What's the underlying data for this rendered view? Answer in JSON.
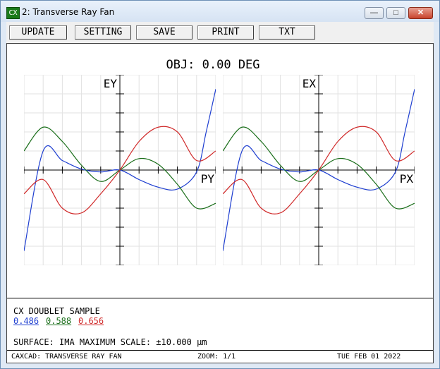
{
  "window": {
    "title": "2: Transverse Ray Fan",
    "icon_label": "CX"
  },
  "toolbar": {
    "buttons": [
      "UPDATE",
      "SETTING",
      "SAVE",
      "PRINT",
      "TXT"
    ]
  },
  "plot": {
    "title": "OBJ: 0.00 DEG"
  },
  "chart_data": [
    {
      "type": "line",
      "xlabel": "PY",
      "ylabel": "EY",
      "xlim": [
        -1,
        1
      ],
      "ylim": [
        -1,
        1
      ],
      "grid": true,
      "series": [
        {
          "name": "0.486",
          "color": "#1f3fd0",
          "x": [
            -1,
            -0.8,
            -0.6,
            -0.4,
            -0.2,
            0,
            0.2,
            0.4,
            0.6,
            0.8,
            0.9,
            1
          ],
          "y": [
            -0.85,
            0.2,
            0.1,
            0.01,
            -0.02,
            0,
            -0.1,
            -0.18,
            -0.2,
            -0.02,
            0.4,
            0.85
          ]
        },
        {
          "name": "0.588",
          "color": "#1a6e1a",
          "x": [
            -1,
            -0.8,
            -0.6,
            -0.4,
            -0.2,
            0,
            0.2,
            0.4,
            0.6,
            0.8,
            1
          ],
          "y": [
            0.2,
            0.45,
            0.3,
            0.05,
            -0.12,
            0,
            0.12,
            0.06,
            -0.15,
            -0.4,
            -0.35
          ]
        },
        {
          "name": "0.656",
          "color": "#d02a2a",
          "x": [
            -1,
            -0.8,
            -0.6,
            -0.4,
            -0.2,
            0,
            0.2,
            0.4,
            0.6,
            0.8,
            1
          ],
          "y": [
            -0.25,
            -0.1,
            -0.4,
            -0.45,
            -0.25,
            0,
            0.3,
            0.45,
            0.4,
            0.1,
            0.2
          ]
        }
      ]
    },
    {
      "type": "line",
      "xlabel": "PX",
      "ylabel": "EX",
      "xlim": [
        -1,
        1
      ],
      "ylim": [
        -1,
        1
      ],
      "grid": true,
      "series": [
        {
          "name": "0.486",
          "color": "#1f3fd0",
          "x": [
            -1,
            -0.8,
            -0.6,
            -0.4,
            -0.2,
            0,
            0.2,
            0.4,
            0.6,
            0.8,
            0.9,
            1
          ],
          "y": [
            -0.85,
            0.2,
            0.1,
            0.01,
            -0.02,
            0,
            -0.1,
            -0.18,
            -0.2,
            -0.02,
            0.4,
            0.85
          ]
        },
        {
          "name": "0.588",
          "color": "#1a6e1a",
          "x": [
            -1,
            -0.8,
            -0.6,
            -0.4,
            -0.2,
            0,
            0.2,
            0.4,
            0.6,
            0.8,
            1
          ],
          "y": [
            0.2,
            0.45,
            0.3,
            0.05,
            -0.12,
            0,
            0.12,
            0.06,
            -0.15,
            -0.4,
            -0.35
          ]
        },
        {
          "name": "0.656",
          "color": "#d02a2a",
          "x": [
            -1,
            -0.8,
            -0.6,
            -0.4,
            -0.2,
            0,
            0.2,
            0.4,
            0.6,
            0.8,
            1
          ],
          "y": [
            -0.25,
            -0.1,
            -0.4,
            -0.45,
            -0.25,
            0,
            0.3,
            0.45,
            0.4,
            0.1,
            0.2
          ]
        }
      ]
    }
  ],
  "info": {
    "lens_name": "CX DOUBLET SAMPLE",
    "wavelengths": [
      {
        "label": "0.486",
        "color": "#1f3fd0"
      },
      {
        "label": "0.588",
        "color": "#1a6e1a"
      },
      {
        "label": "0.656",
        "color": "#d02a2a"
      }
    ],
    "surface_line": "SURFACE: IMA  MAXIMUM SCALE: ±10.000 µm"
  },
  "status": {
    "left": "CAXCAD: TRANSVERSE RAY FAN",
    "zoom": "ZOOM: 1/1",
    "date": "TUE FEB 01 2022"
  }
}
